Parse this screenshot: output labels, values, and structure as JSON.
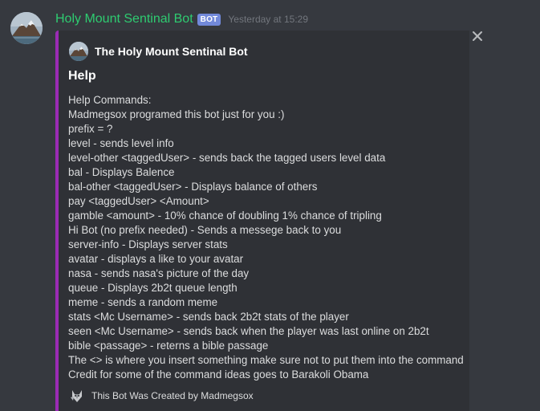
{
  "message": {
    "username": "Holy Mount Sentinal Bot",
    "bot_tag": "BOT",
    "timestamp": "Yesterday at 15:29",
    "avatar_icon": "mountain-avatar-icon"
  },
  "embed": {
    "accent_color": "#9b2bb5",
    "author": {
      "name": "The Holy Mount Sentinal Bot",
      "icon": "mountain-avatar-icon"
    },
    "title": "Help",
    "description_lines": [
      "Help Commands:",
      "Madmegsox programed this bot just for you :)",
      "prefix = ?",
      "level - sends level info",
      "level-other <taggedUser> - sends back the tagged users level data",
      "bal - Displays Balence",
      "bal-other <taggedUser> - Displays balance of others",
      "pay <taggedUser> <Amount>",
      "gamble <amount> - 10% chance of doubling 1% chance of tripling",
      "Hi Bot (no prefix needed) - Sends a messege back to you",
      "server-info - Displays server stats",
      "avatar - displays a like to your avatar",
      "nasa - sends nasa's picture of the day",
      "queue - Displays 2b2t queue length",
      "meme - sends a random meme",
      "stats <Mc Username> - sends back 2b2t stats of the player",
      "seen <Mc Username> - sends back when the player was last online on 2b2t",
      "bible <passage> - reterns a bible passage",
      "The <> is where you insert something make sure not to put them into the command",
      "Credit for some of the command ideas goes to Barakoli Obama"
    ],
    "footer": {
      "text": "This Bot Was Created by Madmegsox",
      "icon": "wolf-footer-icon"
    }
  },
  "controls": {
    "close_icon": "close-icon"
  },
  "colors": {
    "background": "#36393f",
    "embed_background": "#2f3136",
    "username": "#2ecc71",
    "bot_tag": "#7289da",
    "timestamp": "#72767d"
  }
}
